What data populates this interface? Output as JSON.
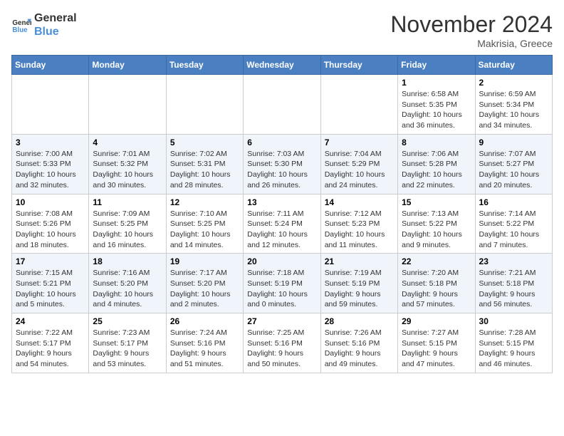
{
  "header": {
    "logo_line1": "General",
    "logo_line2": "Blue",
    "month": "November 2024",
    "location": "Makrisia, Greece"
  },
  "weekdays": [
    "Sunday",
    "Monday",
    "Tuesday",
    "Wednesday",
    "Thursday",
    "Friday",
    "Saturday"
  ],
  "weeks": [
    [
      {
        "day": "",
        "info": ""
      },
      {
        "day": "",
        "info": ""
      },
      {
        "day": "",
        "info": ""
      },
      {
        "day": "",
        "info": ""
      },
      {
        "day": "",
        "info": ""
      },
      {
        "day": "1",
        "info": "Sunrise: 6:58 AM\nSunset: 5:35 PM\nDaylight: 10 hours\nand 36 minutes."
      },
      {
        "day": "2",
        "info": "Sunrise: 6:59 AM\nSunset: 5:34 PM\nDaylight: 10 hours\nand 34 minutes."
      }
    ],
    [
      {
        "day": "3",
        "info": "Sunrise: 7:00 AM\nSunset: 5:33 PM\nDaylight: 10 hours\nand 32 minutes."
      },
      {
        "day": "4",
        "info": "Sunrise: 7:01 AM\nSunset: 5:32 PM\nDaylight: 10 hours\nand 30 minutes."
      },
      {
        "day": "5",
        "info": "Sunrise: 7:02 AM\nSunset: 5:31 PM\nDaylight: 10 hours\nand 28 minutes."
      },
      {
        "day": "6",
        "info": "Sunrise: 7:03 AM\nSunset: 5:30 PM\nDaylight: 10 hours\nand 26 minutes."
      },
      {
        "day": "7",
        "info": "Sunrise: 7:04 AM\nSunset: 5:29 PM\nDaylight: 10 hours\nand 24 minutes."
      },
      {
        "day": "8",
        "info": "Sunrise: 7:06 AM\nSunset: 5:28 PM\nDaylight: 10 hours\nand 22 minutes."
      },
      {
        "day": "9",
        "info": "Sunrise: 7:07 AM\nSunset: 5:27 PM\nDaylight: 10 hours\nand 20 minutes."
      }
    ],
    [
      {
        "day": "10",
        "info": "Sunrise: 7:08 AM\nSunset: 5:26 PM\nDaylight: 10 hours\nand 18 minutes."
      },
      {
        "day": "11",
        "info": "Sunrise: 7:09 AM\nSunset: 5:25 PM\nDaylight: 10 hours\nand 16 minutes."
      },
      {
        "day": "12",
        "info": "Sunrise: 7:10 AM\nSunset: 5:25 PM\nDaylight: 10 hours\nand 14 minutes."
      },
      {
        "day": "13",
        "info": "Sunrise: 7:11 AM\nSunset: 5:24 PM\nDaylight: 10 hours\nand 12 minutes."
      },
      {
        "day": "14",
        "info": "Sunrise: 7:12 AM\nSunset: 5:23 PM\nDaylight: 10 hours\nand 11 minutes."
      },
      {
        "day": "15",
        "info": "Sunrise: 7:13 AM\nSunset: 5:22 PM\nDaylight: 10 hours\nand 9 minutes."
      },
      {
        "day": "16",
        "info": "Sunrise: 7:14 AM\nSunset: 5:22 PM\nDaylight: 10 hours\nand 7 minutes."
      }
    ],
    [
      {
        "day": "17",
        "info": "Sunrise: 7:15 AM\nSunset: 5:21 PM\nDaylight: 10 hours\nand 5 minutes."
      },
      {
        "day": "18",
        "info": "Sunrise: 7:16 AM\nSunset: 5:20 PM\nDaylight: 10 hours\nand 4 minutes."
      },
      {
        "day": "19",
        "info": "Sunrise: 7:17 AM\nSunset: 5:20 PM\nDaylight: 10 hours\nand 2 minutes."
      },
      {
        "day": "20",
        "info": "Sunrise: 7:18 AM\nSunset: 5:19 PM\nDaylight: 10 hours\nand 0 minutes."
      },
      {
        "day": "21",
        "info": "Sunrise: 7:19 AM\nSunset: 5:19 PM\nDaylight: 9 hours\nand 59 minutes."
      },
      {
        "day": "22",
        "info": "Sunrise: 7:20 AM\nSunset: 5:18 PM\nDaylight: 9 hours\nand 57 minutes."
      },
      {
        "day": "23",
        "info": "Sunrise: 7:21 AM\nSunset: 5:18 PM\nDaylight: 9 hours\nand 56 minutes."
      }
    ],
    [
      {
        "day": "24",
        "info": "Sunrise: 7:22 AM\nSunset: 5:17 PM\nDaylight: 9 hours\nand 54 minutes."
      },
      {
        "day": "25",
        "info": "Sunrise: 7:23 AM\nSunset: 5:17 PM\nDaylight: 9 hours\nand 53 minutes."
      },
      {
        "day": "26",
        "info": "Sunrise: 7:24 AM\nSunset: 5:16 PM\nDaylight: 9 hours\nand 51 minutes."
      },
      {
        "day": "27",
        "info": "Sunrise: 7:25 AM\nSunset: 5:16 PM\nDaylight: 9 hours\nand 50 minutes."
      },
      {
        "day": "28",
        "info": "Sunrise: 7:26 AM\nSunset: 5:16 PM\nDaylight: 9 hours\nand 49 minutes."
      },
      {
        "day": "29",
        "info": "Sunrise: 7:27 AM\nSunset: 5:15 PM\nDaylight: 9 hours\nand 47 minutes."
      },
      {
        "day": "30",
        "info": "Sunrise: 7:28 AM\nSunset: 5:15 PM\nDaylight: 9 hours\nand 46 minutes."
      }
    ]
  ]
}
